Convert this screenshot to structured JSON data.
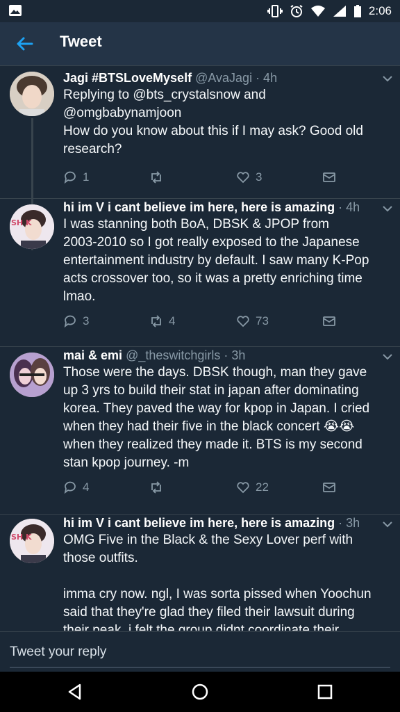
{
  "status": {
    "time": "2:06"
  },
  "header": {
    "title": "Tweet"
  },
  "tweets": [
    {
      "name": "Jagi #BTSLoveMyself",
      "handle": "@AvaJagi · 4h",
      "reply_to_1": "Replying to @bts_crystalsnow and",
      "reply_to_2": "@omgbabynamjoon",
      "lines": [
        "How do you know about this if I may ask? Good old",
        "research?"
      ],
      "replies": "1",
      "retweets": "",
      "likes": "3"
    },
    {
      "name": "hi im V i cant believe im here, here is amazing",
      "handle": "· 4h",
      "lines": [
        "I was stanning both BoA, DBSK & JPOP from",
        "2003-2010 so I got really exposed to the Japanese",
        "entertainment industry by default. I saw many K-Pop",
        "acts crossover too, so it was a pretty enriching time",
        "lmao."
      ],
      "replies": "3",
      "retweets": "4",
      "likes": "73"
    },
    {
      "name": "mai & emi",
      "handle": "@_theswitchgirls · 3h",
      "lines": [
        "Those were the days. DBSK though, man they gave",
        "up 3 yrs to build their stat in japan after dominating",
        "korea. They paved the way for kpop in Japan.  I cried",
        "when they had their five in the black concert 😭😭",
        "when they realized they made it. BTS is my second",
        "stan kpop journey. -m"
      ],
      "replies": "4",
      "retweets": "",
      "likes": "22"
    },
    {
      "name": "hi im V i cant believe im here, here is amazing",
      "handle": "· 3h",
      "lines": [
        "OMG Five in the Black & the Sexy Lover perf with",
        "those outfits.",
        "",
        "imma cry now. ngl, I was sorta pissed when Yoochun",
        "said that they're glad they filed their lawsuit during",
        "their peak. i felt the group didnt coordinate their"
      ]
    }
  ],
  "avatar_labels": {
    "v": "SH K"
  },
  "reply_bar": {
    "placeholder": "Tweet your reply"
  },
  "colors": {
    "accent": "#1da1f2",
    "background": "#1b2836",
    "muted": "#8899a6"
  }
}
